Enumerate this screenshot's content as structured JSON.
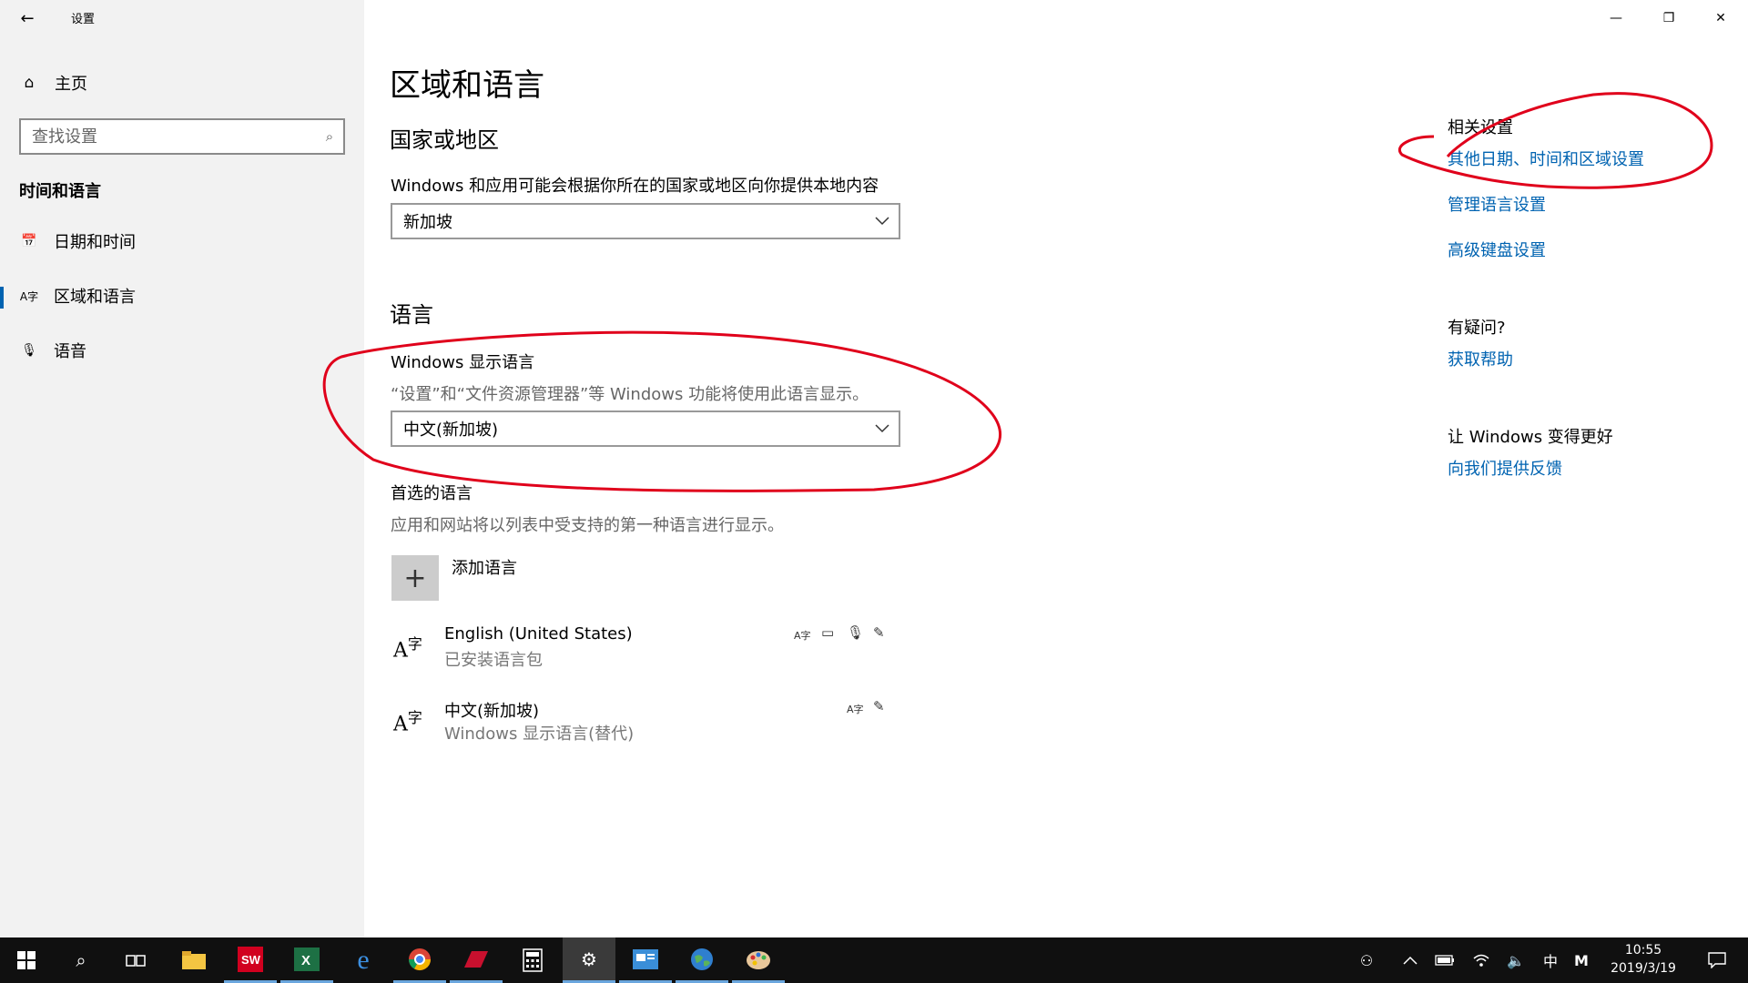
{
  "window": {
    "title": "设置",
    "back_icon": "←",
    "controls": {
      "minimize": "—",
      "restore": "❐",
      "close": "✕"
    }
  },
  "sidebar": {
    "home": {
      "icon": "⌂",
      "label": "主页"
    },
    "search": {
      "placeholder": "查找设置",
      "icon": "⌕"
    },
    "section_heading": "时间和语言",
    "items": [
      {
        "icon": "📅",
        "label": "日期和时间",
        "selected": false
      },
      {
        "icon": "A字",
        "label": "区域和语言",
        "selected": true
      },
      {
        "icon": "🎙",
        "label": "语音",
        "selected": false
      }
    ]
  },
  "main": {
    "title": "区域和语言",
    "country": {
      "heading": "国家或地区",
      "label": "Windows 和应用可能会根据你所在的国家或地区向你提供本地内容",
      "value": "新加坡"
    },
    "language": {
      "heading": "语言",
      "display_label": "Windows 显示语言",
      "display_desc": "“设置”和“文件资源管理器”等 Windows 功能将使用此语言显示。",
      "display_value": "中文(新加坡)",
      "preferred_label": "首选的语言",
      "preferred_desc": "应用和网站将以列表中受支持的第一种语言进行显示。",
      "add_label": "添加语言",
      "list": [
        {
          "name": "English (United States)",
          "sub": "已安装语言包",
          "features": [
            "A字",
            "▭",
            "🎙",
            "✎"
          ]
        },
        {
          "name": "中文(新加坡)",
          "sub": "Windows 显示语言(替代)",
          "features": [
            "A字",
            "✎"
          ]
        }
      ]
    }
  },
  "right": {
    "related_heading": "相关设置",
    "related_links": [
      "其他日期、时间和区域设置",
      "管理语言设置",
      "高级键盘设置"
    ],
    "question_heading": "有疑问?",
    "help_link": "获取帮助",
    "improve_heading": "让 Windows 变得更好",
    "feedback_link": "向我们提供反馈"
  },
  "taskbar": {
    "apps": [
      "start",
      "search",
      "task-view",
      "file-explorer",
      "solidworks-2018",
      "excel",
      "edge",
      "chrome",
      "app-red",
      "calculator",
      "settings",
      "app-blue",
      "globe-app",
      "paint-app"
    ],
    "tray_ime": "中",
    "tray_m": "M",
    "time": "10:55",
    "date": "2019/3/19"
  },
  "colors": {
    "accent": "#0063b1",
    "annotation": "#e0001b",
    "sidebar_bg": "#f2f2f2",
    "taskbar_bg": "#101010"
  }
}
